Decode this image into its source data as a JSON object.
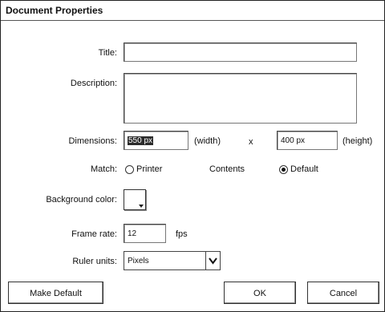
{
  "window": {
    "title": "Document Properties"
  },
  "fields": {
    "title": {
      "label": "Title:",
      "value": ""
    },
    "description": {
      "label": "Description:",
      "value": ""
    },
    "dimensions": {
      "label": "Dimensions:",
      "width": "550 px",
      "width_unit": "(width)",
      "separator": "x",
      "height": "400 px",
      "height_unit": "(height)"
    },
    "match": {
      "label": "Match:",
      "printer": "Printer",
      "contents": "Contents",
      "default": "Default",
      "selected": "Default"
    },
    "background": {
      "label": "Background color:",
      "color": "#ffffff"
    },
    "frame_rate": {
      "label": "Frame rate:",
      "value": "12",
      "unit": "fps"
    },
    "ruler_units": {
      "label": "Ruler units:",
      "value": "Pixels"
    }
  },
  "buttons": {
    "make_default": "Make Default",
    "ok": "OK",
    "cancel": "Cancel"
  }
}
